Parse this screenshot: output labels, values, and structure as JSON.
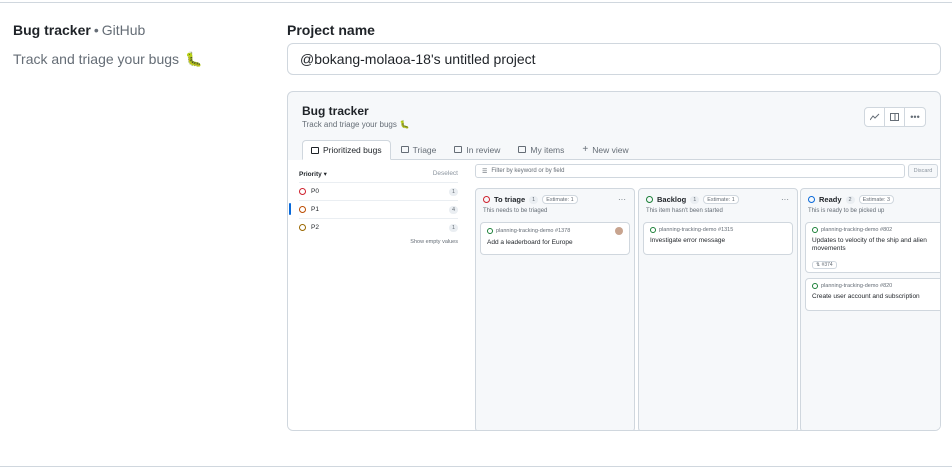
{
  "template": {
    "name": "Bug tracker",
    "separator": "•",
    "owner": "GitHub",
    "description": "Track and triage your bugs",
    "emoji": "🐛"
  },
  "form": {
    "label": "Project name",
    "value": "@bokang-molaoa-18's untitled project"
  },
  "preview": {
    "title": "Bug tracker",
    "description": "Track and triage your bugs",
    "tabs": [
      {
        "label": "Prioritized bugs",
        "icon": "board-icon"
      },
      {
        "label": "Triage",
        "icon": "table-icon"
      },
      {
        "label": "In review",
        "icon": "table-icon"
      },
      {
        "label": "My items",
        "icon": "table-icon"
      },
      {
        "label": "New view",
        "icon": "plus-icon"
      }
    ],
    "filter_placeholder": "Filter by keyword or by field",
    "discard_label": "Discard",
    "side": {
      "heading": "Priority",
      "deselect": "Deselect",
      "items": [
        {
          "label": "P0",
          "count": "1",
          "color": "#cf222e"
        },
        {
          "label": "P1",
          "count": "4",
          "color": "#bc4c00"
        },
        {
          "label": "P2",
          "count": "1",
          "color": "#9a6700"
        }
      ],
      "show_empty": "Show empty values"
    },
    "columns": [
      {
        "title": "To triage",
        "count": "1",
        "estimate": "Estimate: 1",
        "color": "#cf222e",
        "subtitle": "This needs to be triaged",
        "cards": [
          {
            "ref": "planning-tracking-demo #1378",
            "title": "Add a leaderboard for Europe"
          }
        ]
      },
      {
        "title": "Backlog",
        "count": "1",
        "estimate": "Estimate: 1",
        "color": "#1a7f37",
        "subtitle": "This item hasn't been started",
        "cards": [
          {
            "ref": "planning-tracking-demo #1315",
            "title": "Investigate error message"
          }
        ]
      },
      {
        "title": "Ready",
        "count": "2",
        "estimate": "Estimate: 3",
        "color": "#0969da",
        "subtitle": "This is ready to be picked up",
        "cards": [
          {
            "ref": "planning-tracking-demo #802",
            "title": "Updates to velocity of the ship and alien movements",
            "tag": "#374"
          },
          {
            "ref": "planning-tracking-demo #820",
            "title": "Create user account and subscription"
          }
        ]
      }
    ]
  }
}
